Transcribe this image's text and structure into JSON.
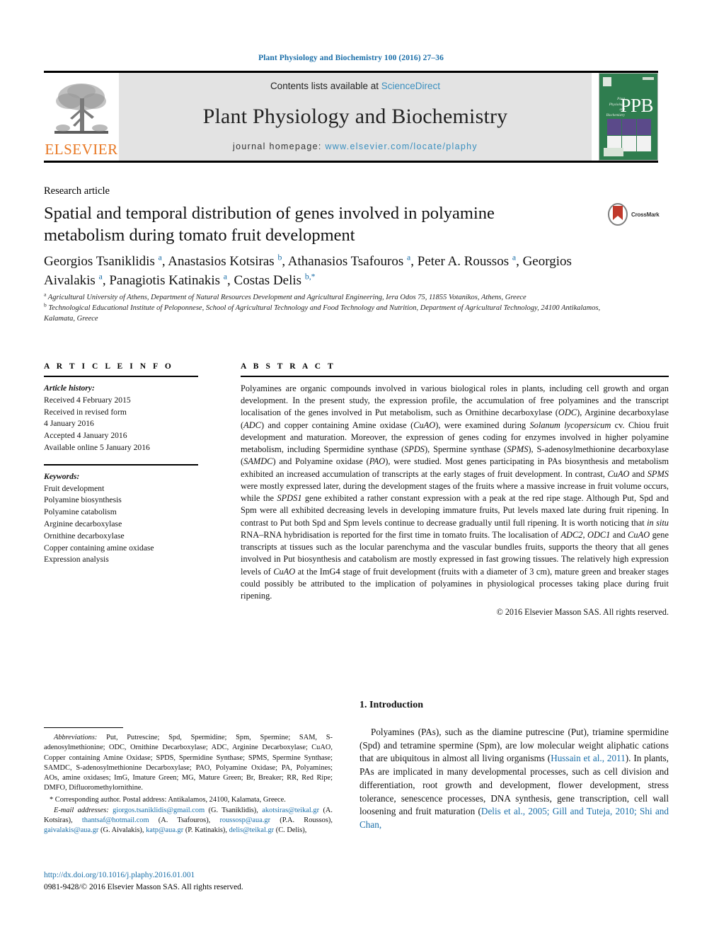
{
  "running_head": "Plant Physiology and Biochemistry 100 (2016) 27–36",
  "banner": {
    "publisher_logo_name": "elsevier-tree-logo",
    "publisher_name": "ELSEVIER",
    "contents_prefix": "Contents lists available at ",
    "contents_link": "ScienceDirect",
    "journal_title": "Plant Physiology and Biochemistry",
    "homepage_prefix": "journal homepage: ",
    "homepage_url": "www.elsevier.com/locate/plaphy",
    "cover": {
      "acronym": "PPB",
      "subtitle": "Plant Physiology and Biochemistry"
    },
    "link_color": "#3a8fbf",
    "band_color": "#e3e3e3",
    "cover_color": "#2f7d4f"
  },
  "article": {
    "type": "Research article",
    "title": "Spatial and temporal distribution of genes involved in polyamine metabolism during tomato fruit development",
    "crossmark_label": "CrossMark",
    "authors_html": "Georgios Tsaniklidis <sup>a</sup>, Anastasios Kotsiras <sup>b</sup>, Athanasios Tsafouros <sup>a</sup>, Peter A. Roussos <sup>a</sup>, Georgios Aivalakis <sup>a</sup>, Panagiotis Katinakis <sup>a</sup>, Costas Delis <sup>b,</sup><sup>*</sup>",
    "affiliations": [
      {
        "marker": "a",
        "text": "Agricultural University of Athens, Department of Natural Resources Development and Agricultural Engineering, Iera Odos 75, 11855 Votanikos, Athens, Greece"
      },
      {
        "marker": "b",
        "text": "Technological Educational Institute of Peloponnese, School of Agricultural Technology and Food Technology and Nutrition, Department of Agricultural Technology, 24100 Antikalamos, Kalamata, Greece"
      }
    ]
  },
  "article_info": {
    "heading": "A R T I C L E   I N F O",
    "history_label": "Article history:",
    "history": [
      "Received 4 February 2015",
      "Received in revised form",
      "4 January 2016",
      "Accepted 4 January 2016",
      "Available online 5 January 2016"
    ],
    "keywords_label": "Keywords:",
    "keywords": [
      "Fruit development",
      "Polyamine biosynthesis",
      "Polyamine catabolism",
      "Arginine decarboxylase",
      "Ornithine decarboxylase",
      "Copper containing amine oxidase",
      "Expression analysis"
    ]
  },
  "abstract": {
    "heading": "A B S T R A C T",
    "text_html": "Polyamines are organic compounds involved in various biological roles in plants, including cell growth and organ development. In the present study, the expression profile, the accumulation of free polyamines and the transcript localisation of the genes involved in Put metabolism, such as Ornithine decarboxylase (<i>ODC</i>), Arginine decarboxylase (<i>ADC</i>) and copper containing Amine oxidase (<i>CuAO</i>), were examined during <i>Solanum lycopersicum</i> cv. Chiou fruit development and maturation. Moreover, the expression of genes coding for enzymes involved in higher polyamine metabolism, including Spermidine synthase (<i>SPDS</i>), Spermine synthase (<i>SPMS</i>), S-adenosylmethionine decarboxylase (<i>SAMDC</i>) and Polyamine oxidase (<i>PAO</i>), were studied. Most genes participating in PAs biosynthesis and metabolism exhibited an increased accumulation of transcripts at the early stages of fruit development. In contrast, <i>CuAO</i> and <i>SPMS</i> were mostly expressed later, during the development stages of the fruits where a massive increase in fruit volume occurs, while the <i>SPDS1</i> gene exhibited a rather constant expression with a peak at the red ripe stage. Although Put, Spd and Spm were all exhibited decreasing levels in developing immature fruits, Put levels maxed late during fruit ripening. In contrast to Put both Spd and Spm levels continue to decrease gradually until full ripening. It is worth noticing that <i>in situ</i> RNA&ndash;RNA hybridisation is reported for the first time in tomato fruits. The localisation of <i>ADC2</i>, <i>ODC1</i> and <i>CuAO</i> gene transcripts at tissues such as the locular parenchyma and the vascular bundles fruits, supports the theory that all genes involved in Put biosynthesis and catabolism are mostly expressed in fast growing tissues. The relatively high expression levels of <i>CuAO</i> at the ImG4 stage of fruit development (fruits with a diameter of 3 cm), mature green and breaker stages could possibly be attributed to the implication of polyamines in physiological processes taking place during fruit ripening.",
    "copyright": "© 2016 Elsevier Masson SAS. All rights reserved."
  },
  "footnotes": {
    "abbreviations_label": "Abbreviations:",
    "abbreviations_text": " Put, Putrescine; Spd, Spermidine; Spm, Spermine; SAM, S-adenosylmethionine; ODC, Ornithine Decarboxylase; ADC, Arginine Decarboxylase; CuAO, Copper containing Amine Oxidase; SPDS, Spermidine Synthase; SPMS, Spermine Synthase; SAMDC, S-adenosylmethionine Decarboxylase; PAO, Polyamine Oxidase; PA, Polyamines; AOs, amine oxidases; ImG, Imature Green; MG, Mature Green; Br, Breaker; RR, Red Ripe; DMFO, Difluoromethylornithine.",
    "corresponding": "* Corresponding author. Postal address: Antikalamos, 24100, Kalamata, Greece.",
    "email_label": "E-mail addresses:",
    "emails": [
      {
        "address": "giorgos.tsaniklidis@gmail.com",
        "person": "(G. Tsaniklidis)"
      },
      {
        "address": "akotsiras@teikal.gr",
        "person": "(A. Kotsiras)"
      },
      {
        "address": "thantsaf@hotmail.com",
        "person": "(A. Tsafouros)"
      },
      {
        "address": "roussosp@aua.gr",
        "person": "(P.A. Roussos)"
      },
      {
        "address": "gaivalakis@aua.gr",
        "person": "(G. Aivalakis)"
      },
      {
        "address": "katp@aua.gr",
        "person": "(P. Katinakis)"
      },
      {
        "address": "delis@teikal.gr",
        "person": "(C. Delis)"
      }
    ]
  },
  "doi_block": {
    "doi_url": "http://dx.doi.org/10.1016/j.plaphy.2016.01.001",
    "issn_line": "0981-9428/© 2016 Elsevier Masson SAS. All rights reserved."
  },
  "introduction": {
    "heading": "1. Introduction",
    "paragraph_html": "Polyamines (PAs), such as the diamine putrescine (Put), triamine spermidine (Spd) and tetramine spermine (Spm), are low molecular weight aliphatic cations that are ubiquitous in almost all living organisms (<span class=\"lnk\">Hussain et al., 2011</span>). In plants, PAs are implicated in many developmental processes, such as cell division and differentiation, root growth and development, flower development, stress tolerance, senescence processes, DNA synthesis, gene transcription, cell wall loosening and fruit maturation (<span class=\"lnk\">Delis et al., 2005; Gill and Tuteja, 2010; Shi and Chan,</span>"
  },
  "colors": {
    "link": "#1a6ea8",
    "elsevier_orange": "#E87722",
    "cover_green": "#2f7d4f"
  }
}
